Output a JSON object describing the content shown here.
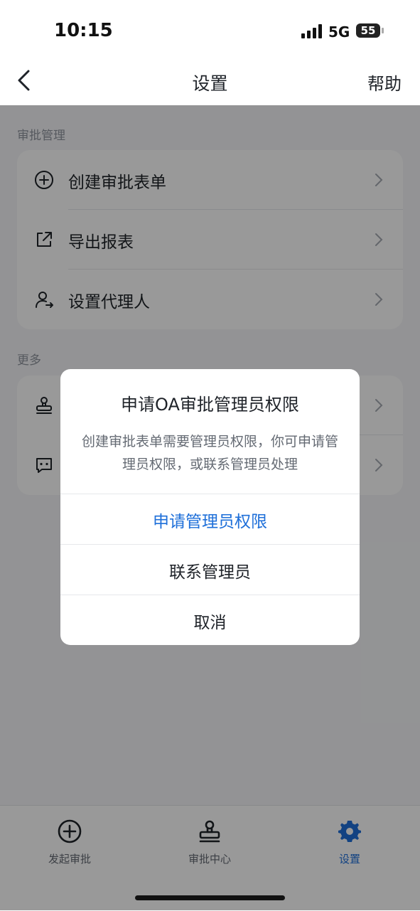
{
  "status_bar": {
    "time": "10:15",
    "network": "5G",
    "battery": "55"
  },
  "nav": {
    "title": "设置",
    "help": "帮助"
  },
  "sections": [
    {
      "title": "审批管理",
      "items": [
        {
          "icon": "plus-circle-icon",
          "label": "创建审批表单"
        },
        {
          "icon": "export-icon",
          "label": "导出报表"
        },
        {
          "icon": "user-transfer-icon",
          "label": "设置代理人"
        }
      ]
    },
    {
      "title": "更多",
      "items": [
        {
          "icon": "stamp-icon",
          "label": ""
        },
        {
          "icon": "message-icon",
          "label": ""
        }
      ]
    }
  ],
  "tabbar": {
    "items": [
      {
        "icon": "plus-circle-icon",
        "label": "发起审批",
        "active": false
      },
      {
        "icon": "stamp-icon",
        "label": "审批中心",
        "active": false
      },
      {
        "icon": "gear-icon",
        "label": "设置",
        "active": true
      }
    ]
  },
  "dialog": {
    "title": "申请OA审批管理员权限",
    "message": "创建审批表单需要管理员权限，你可申请管理员权限，或联系管理员处理",
    "actions": {
      "request": "申请管理员权限",
      "contact": "联系管理员",
      "cancel": "取消"
    }
  },
  "colors": {
    "accent": "#1e6fd9",
    "text": "#1f2329",
    "muted": "#8f959e",
    "background": "#f5f6f8"
  }
}
